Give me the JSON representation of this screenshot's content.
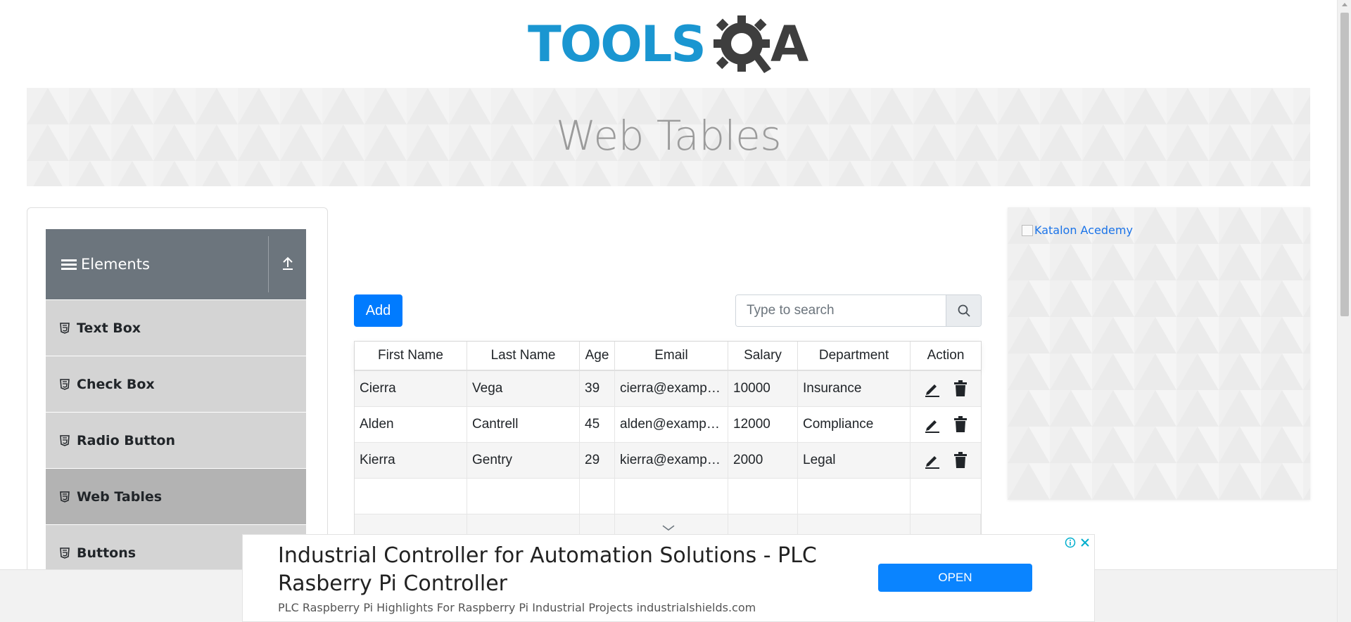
{
  "header": {
    "logo_text": "TOOLSQA",
    "logo_word": "TOOLS",
    "logo_letter": "A"
  },
  "banner": {
    "title": "Web Tables"
  },
  "sidebar": {
    "group_title": "Elements",
    "items": [
      {
        "label": "Text Box"
      },
      {
        "label": "Check Box"
      },
      {
        "label": "Radio Button"
      },
      {
        "label": "Web Tables",
        "active": true
      },
      {
        "label": "Buttons"
      }
    ]
  },
  "main": {
    "add_label": "Add",
    "search": {
      "placeholder": "Type to search",
      "value": ""
    },
    "table": {
      "headers": [
        "First Name",
        "Last Name",
        "Age",
        "Email",
        "Salary",
        "Department",
        "Action"
      ],
      "rows": [
        [
          "Cierra",
          "Vega",
          "39",
          "cierra@example.com",
          "10000",
          "Insurance"
        ],
        [
          "Alden",
          "Cantrell",
          "45",
          "alden@example.com",
          "12000",
          "Compliance"
        ],
        [
          "Kierra",
          "Gentry",
          "29",
          "kierra@example.com",
          "2000",
          "Legal"
        ]
      ]
    }
  },
  "right_ad": {
    "alt_text": "Katalon Acedemy"
  },
  "bottom_ad": {
    "title": "Industrial Controller for Automation Solutions - PLC Rasberry Pi Controller",
    "subtitle": "PLC Raspberry Pi Highlights For Raspberry Pi Industrial Projects industrialshields.com",
    "button_label": "OPEN"
  },
  "colors": {
    "primary": "#007bff",
    "logo_blue": "#1a96d1",
    "logo_dark": "#3e3e3e",
    "sidebar_header": "#6c757d",
    "menu_item": "#d4d4d4",
    "menu_active": "#b3b3b3"
  }
}
